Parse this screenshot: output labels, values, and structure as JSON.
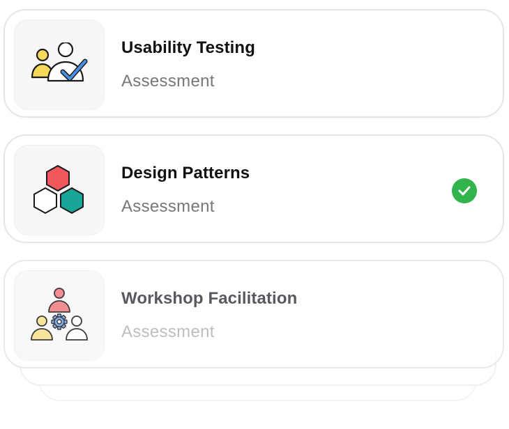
{
  "items": [
    {
      "title": "Usability Testing",
      "subtitle": "Assessment",
      "icon": "usability-testing-icon",
      "completed": false
    },
    {
      "title": "Design Patterns",
      "subtitle": "Assessment",
      "icon": "design-patterns-icon",
      "completed": true
    },
    {
      "title": "Workshop Facilitation",
      "subtitle": "Assessment",
      "icon": "workshop-facilitation-icon",
      "completed": false
    }
  ],
  "colors": {
    "check_green": "#31b44b",
    "hex_red": "#f0575c",
    "hex_teal": "#16a596",
    "person_yellow": "#f7d95a",
    "check_blue": "#4a8fe0"
  }
}
